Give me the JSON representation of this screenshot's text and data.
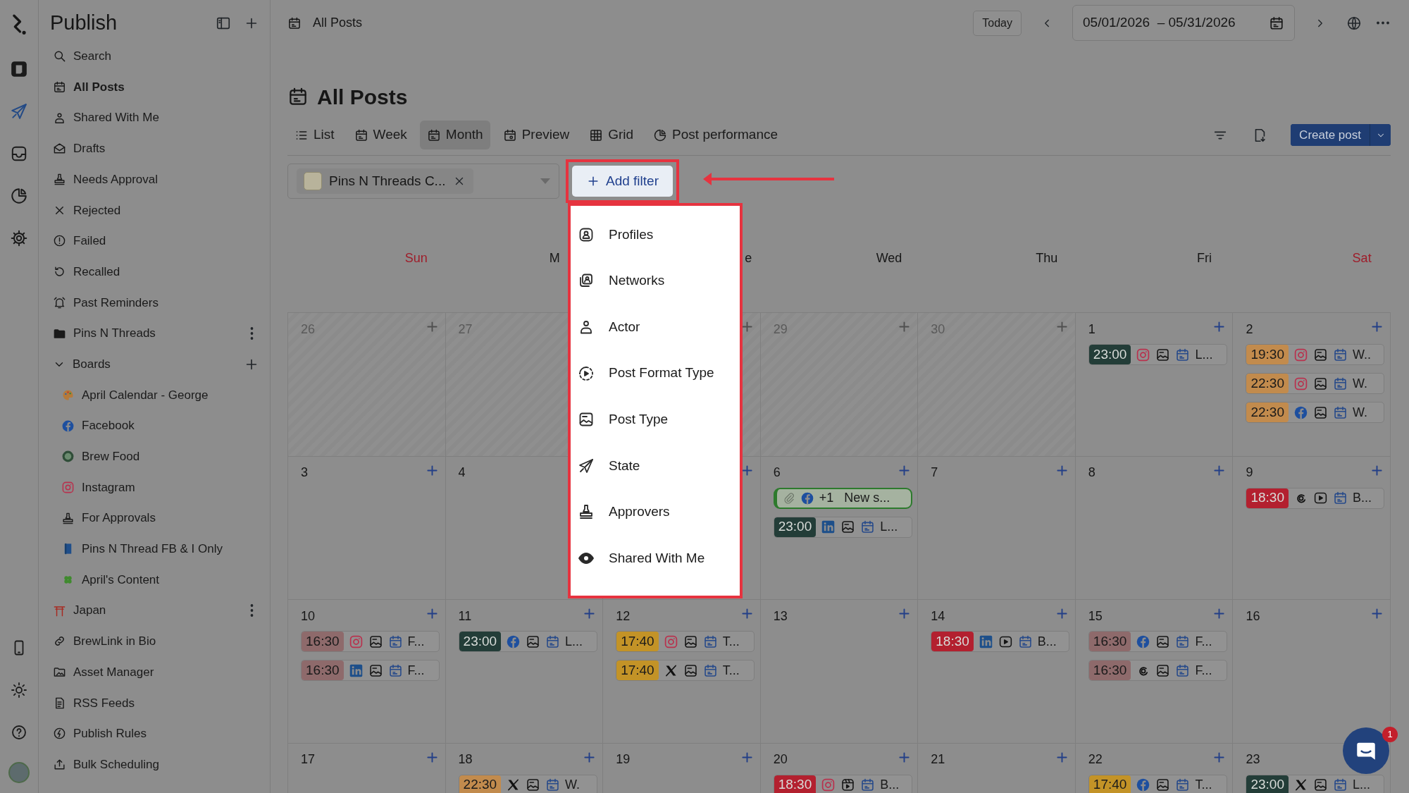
{
  "rail": {
    "items": [
      {
        "selected": false
      },
      {
        "selected": true
      },
      {
        "selected": false
      },
      {
        "selected": false
      },
      {
        "selected": false
      }
    ]
  },
  "sidebar": {
    "title": "Publish",
    "items": [
      {
        "label": "Search",
        "selected": false
      },
      {
        "label": "All Posts",
        "selected": true
      },
      {
        "label": "Shared With Me",
        "selected": false
      },
      {
        "label": "Drafts",
        "selected": false
      },
      {
        "label": "Needs Approval",
        "selected": false
      },
      {
        "label": "Rejected",
        "selected": false
      },
      {
        "label": "Failed",
        "selected": false
      },
      {
        "label": "Recalled",
        "selected": false
      },
      {
        "label": "Past Reminders",
        "selected": false
      },
      {
        "label": "Pins N Threads",
        "selected": false,
        "has_menu": true
      },
      {
        "label": "Boards",
        "selected": false,
        "expanded": true,
        "children": [
          {
            "label": "April Calendar - George",
            "selected": false
          },
          {
            "label": "Facebook",
            "selected": false
          },
          {
            "label": "Brew Food",
            "selected": false
          },
          {
            "label": "Instagram",
            "selected": false
          },
          {
            "label": "For Approvals",
            "selected": false
          },
          {
            "label": "Pins N Thread FB & I Only",
            "selected": false
          },
          {
            "label": "April's Content",
            "selected": false
          }
        ]
      },
      {
        "label": "Japan",
        "selected": false,
        "has_menu": true
      },
      {
        "label": "BrewLink in Bio",
        "selected": false
      },
      {
        "label": "Asset Manager",
        "selected": false
      },
      {
        "label": "RSS Feeds",
        "selected": false
      },
      {
        "label": "Publish Rules",
        "selected": false
      },
      {
        "label": "Bulk Scheduling",
        "selected": false
      }
    ]
  },
  "topbar": {
    "breadcrumb": "All Posts",
    "today": "Today",
    "date_range": "05/01/2026  – 05/31/2026"
  },
  "page": {
    "title": "All Posts",
    "tabs": [
      {
        "label": "List",
        "selected": false
      },
      {
        "label": "Week",
        "selected": false
      },
      {
        "label": "Month",
        "selected": true
      },
      {
        "label": "Preview",
        "selected": false
      },
      {
        "label": "Grid",
        "selected": false
      },
      {
        "label": "Post performance",
        "selected": false
      }
    ],
    "create_button": "Create post"
  },
  "filter": {
    "chip": "Pins N Threads C...",
    "add_button": "Add filter",
    "menu": [
      "Profiles",
      "Networks",
      "Actor",
      "Post Format Type",
      "Post Type",
      "State",
      "Approvers",
      "Shared With Me"
    ]
  },
  "chat": {
    "badge": "1"
  },
  "calendar": {
    "days": [
      {
        "label": "Sun",
        "weekend": true
      },
      {
        "label": "M",
        "weekend": false,
        "kind": "clipped_end"
      },
      {
        "label": "e",
        "weekend": false,
        "kind": "clipped_start"
      },
      {
        "label": "Wed",
        "weekend": false
      },
      {
        "label": "Thu",
        "weekend": false
      },
      {
        "label": "Fri",
        "weekend": false
      },
      {
        "label": "Sat",
        "weekend": true
      }
    ],
    "weeks": [
      [
        {
          "date": "26",
          "outside": true,
          "add": true
        },
        {
          "date": "27",
          "outside": true
        },
        {
          "outside": true,
          "add": true
        },
        {
          "date": "29",
          "outside": true,
          "add": true
        },
        {
          "date": "30",
          "outside": true,
          "add": true
        },
        {
          "date": "1",
          "outside": false,
          "add": true,
          "posts": [
            {
              "kind": "scheduled",
              "time": "23:00",
              "color": "#233d38",
              "network": {
                "kind": "instagram"
              },
              "format": {
                "kind": "image"
              },
              "title": "L..."
            }
          ]
        },
        {
          "date": "2",
          "outside": false,
          "add": true,
          "posts": [
            {
              "kind": "scheduled",
              "time": "19:30",
              "color": "#c28b4d",
              "network": {
                "kind": "instagram"
              },
              "format": {
                "kind": "image"
              },
              "title": "W.."
            },
            {
              "kind": "scheduled",
              "time": "22:30",
              "color": "#c28b4d",
              "network": {
                "kind": "instagram"
              },
              "format": {
                "kind": "image"
              },
              "title": "W."
            },
            {
              "kind": "scheduled",
              "time": "22:30",
              "color": "#c28b4d",
              "network": {
                "kind": "facebook"
              },
              "format": {
                "kind": "image"
              },
              "title": "W."
            }
          ]
        }
      ],
      [
        {
          "date": "3",
          "outside": false,
          "add": true
        },
        {
          "date": "4",
          "outside": false
        },
        {
          "outside": false,
          "add": true
        },
        {
          "date": "6",
          "outside": false,
          "add": true,
          "posts": [
            {
              "kind": "draft",
              "network": {
                "kind": "facebook"
              },
              "extra": "+1",
              "title": "New s..."
            },
            {
              "kind": "scheduled",
              "time": "23:00",
              "color": "#233d38",
              "network": {
                "kind": "linkedin"
              },
              "format": {
                "kind": "image"
              },
              "title": "L..."
            }
          ]
        },
        {
          "date": "7",
          "outside": false,
          "add": true
        },
        {
          "date": "8",
          "outside": false,
          "add": true
        },
        {
          "date": "9",
          "outside": false,
          "add": true,
          "posts": [
            {
              "kind": "scheduled",
              "time": "18:30",
              "color": "#b3202f",
              "network": {
                "kind": "threads"
              },
              "format": {
                "kind": "video"
              },
              "title": "B..."
            }
          ]
        }
      ],
      [
        {
          "date": "10",
          "outside": false,
          "add": true,
          "posts": [
            {
              "kind": "scheduled",
              "time": "16:30",
              "color": "#8e6a6b",
              "network": {
                "kind": "instagram"
              },
              "format": {
                "kind": "image"
              },
              "title": "F..."
            },
            {
              "kind": "scheduled",
              "time": "16:30",
              "color": "#8e6a6b",
              "network": {
                "kind": "linkedin"
              },
              "format": {
                "kind": "image"
              },
              "title": "F..."
            }
          ]
        },
        {
          "date": "11",
          "outside": false,
          "add": true,
          "posts": [
            {
              "kind": "scheduled",
              "time": "23:00",
              "color": "#233d38",
              "network": {
                "kind": "facebook"
              },
              "format": {
                "kind": "image"
              },
              "title": "L..."
            }
          ]
        },
        {
          "date": "12",
          "outside": false,
          "add": true,
          "posts": [
            {
              "kind": "scheduled",
              "time": "17:40",
              "color": "#c39327",
              "network": {
                "kind": "instagram"
              },
              "format": {
                "kind": "image"
              },
              "title": "T..."
            },
            {
              "kind": "scheduled",
              "time": "17:40",
              "color": "#c39327",
              "network": {
                "kind": "x"
              },
              "format": {
                "kind": "image"
              },
              "title": "T..."
            }
          ]
        },
        {
          "date": "13",
          "outside": false,
          "add": true
        },
        {
          "date": "14",
          "outside": false,
          "add": true,
          "posts": [
            {
              "kind": "scheduled",
              "time": "18:30",
              "color": "#b3202f",
              "network": {
                "kind": "linkedin"
              },
              "format": {
                "kind": "video"
              },
              "title": "B..."
            }
          ]
        },
        {
          "date": "15",
          "outside": false,
          "add": true,
          "posts": [
            {
              "kind": "scheduled",
              "time": "16:30",
              "color": "#8e6a6b",
              "network": {
                "kind": "facebook"
              },
              "format": {
                "kind": "image"
              },
              "title": "F..."
            },
            {
              "kind": "scheduled",
              "time": "16:30",
              "color": "#8e6a6b",
              "network": {
                "kind": "threads"
              },
              "format": {
                "kind": "image"
              },
              "title": "F..."
            }
          ]
        },
        {
          "date": "16",
          "outside": false,
          "add": true
        }
      ],
      [
        {
          "date": "17",
          "outside": false,
          "add": true
        },
        {
          "date": "18",
          "outside": false,
          "add": true,
          "posts": [
            {
              "kind": "scheduled",
              "time": "22:30",
              "color": "#c28b4d",
              "network": {
                "kind": "x"
              },
              "format": {
                "kind": "image"
              },
              "title": "W."
            }
          ]
        },
        {
          "date": "19",
          "outside": false,
          "add": true
        },
        {
          "date": "20",
          "outside": false,
          "add": true,
          "posts": [
            {
              "kind": "scheduled",
              "time": "18:30",
              "color": "#b3202f",
              "network": {
                "kind": "instagram"
              },
              "format": {
                "kind": "reel"
              },
              "title": "B..."
            }
          ]
        },
        {
          "date": "21",
          "outside": false,
          "add": true
        },
        {
          "date": "22",
          "outside": false,
          "add": true,
          "posts": [
            {
              "kind": "scheduled",
              "time": "17:40",
              "color": "#c39327",
              "network": {
                "kind": "facebook"
              },
              "format": {
                "kind": "image"
              },
              "title": "T..."
            }
          ]
        },
        {
          "date": "23",
          "outside": false,
          "posts": [
            {
              "kind": "scheduled",
              "time": "23:00",
              "color": "#233d38",
              "network": {
                "kind": "x"
              },
              "format": {
                "kind": "image"
              },
              "title": "L..."
            }
          ]
        }
      ]
    ]
  }
}
